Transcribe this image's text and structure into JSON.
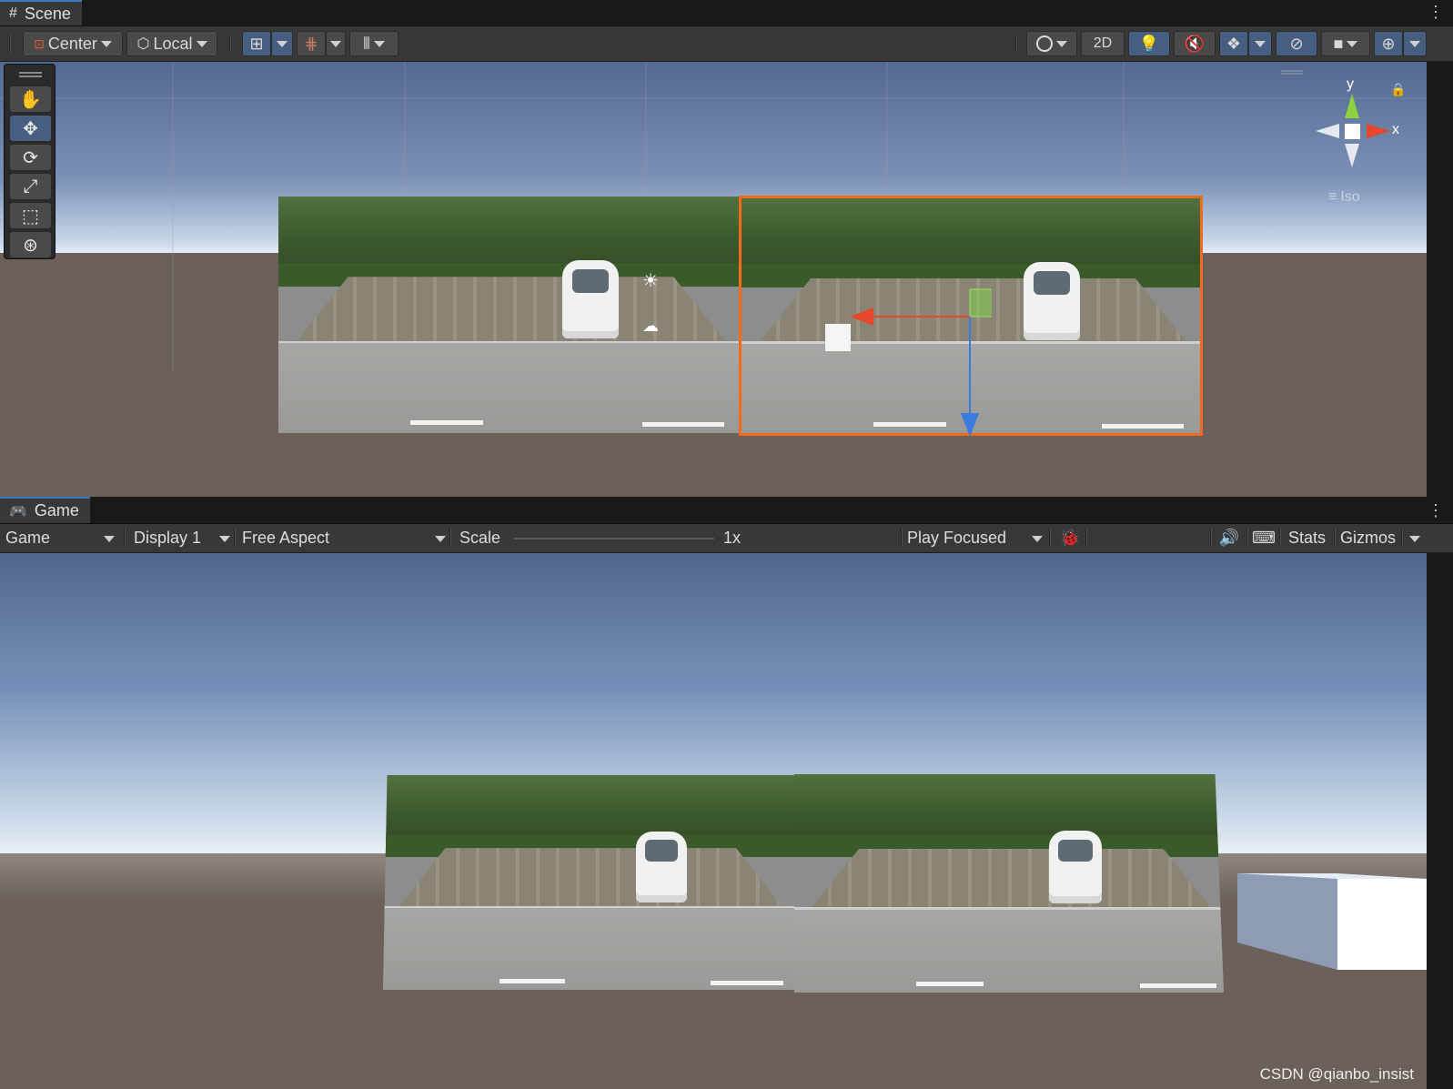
{
  "scene": {
    "tab_label": "Scene",
    "menu": "⋮",
    "toolbar": {
      "pivot_label": "Center",
      "space_label": "Local",
      "mode_2d_label": "2D"
    },
    "gizmo": {
      "y_label": "y",
      "x_label": "x",
      "projection_label": "Iso"
    }
  },
  "game": {
    "tab_label": "Game",
    "menu": "⋮",
    "toolbar": {
      "view_select": "Game",
      "display_select": "Display 1",
      "aspect_select": "Free Aspect",
      "scale_label": "Scale",
      "scale_value": "1x",
      "play_mode_select": "Play Focused",
      "stats_label": "Stats",
      "gizmos_label": "Gizmos"
    }
  },
  "watermark": "CSDN @qianbo_insist",
  "colors": {
    "panel_bg": "#383838",
    "button_bg": "#4a4a4a",
    "active_blue": "#465e7f",
    "selection_orange": "#f26a1b",
    "ground": "#6b615a"
  },
  "icons": {
    "tools": [
      "hand-icon",
      "move-icon",
      "rotate-icon",
      "scale-icon",
      "rect-icon",
      "transform-icon"
    ]
  }
}
